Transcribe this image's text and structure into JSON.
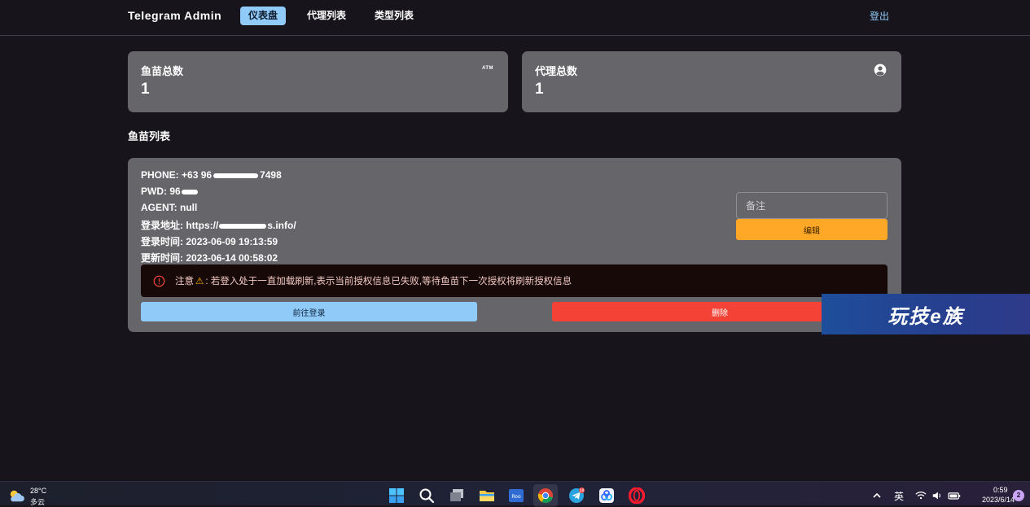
{
  "navbar": {
    "brand": "Telegram Admin",
    "tabs": [
      {
        "label": "仪表盘",
        "active": true
      },
      {
        "label": "代理列表",
        "active": false
      },
      {
        "label": "类型列表",
        "active": false
      }
    ],
    "logout": "登出"
  },
  "stats": [
    {
      "title": "鱼苗总数",
      "value": "1",
      "icon": "atm-icon",
      "icon_text": "ATM"
    },
    {
      "title": "代理总数",
      "value": "1",
      "icon": "account-circle-icon"
    }
  ],
  "section_title": "鱼苗列表",
  "fish_item": {
    "phone_label": "PHONE:",
    "phone_prefix": "+63 96",
    "phone_suffix": "7498",
    "pwd_label": "PWD:",
    "pwd_prefix": "96",
    "agent_label": "AGENT:",
    "agent_value": "null",
    "login_url_label": "登录地址:",
    "login_url_prefix": "https://",
    "login_url_suffix": "s.info/",
    "login_time_label": "登录时间:",
    "login_time_value": "2023-06-09 19:13:59",
    "update_time_label": "更新时间:",
    "update_time_value": "2023-06-14 00:58:02",
    "note_placeholder": "备注",
    "edit_label": "编辑",
    "alert_prefix": "注意",
    "alert_text": ": 若登入处于一直加载刷新,表示当前授权信息已失败,等待鱼苗下一次授权将刷新授权信息",
    "goto_login_label": "前往登录",
    "delete_label": "删除"
  },
  "watermark": "玩技e族",
  "taskbar": {
    "weather_temp": "28°C",
    "weather_cond": "多云",
    "app_label_roo": "Roo",
    "telegram_badge": "18",
    "ime": "英",
    "time": "0:59",
    "date": "2023/6/14",
    "notifications": "2"
  },
  "colors": {
    "background": "#17151b",
    "card": "#666569",
    "primary": "#90caf9",
    "warning": "#ffa726",
    "danger": "#f44336",
    "alert_bg": "#170908"
  }
}
